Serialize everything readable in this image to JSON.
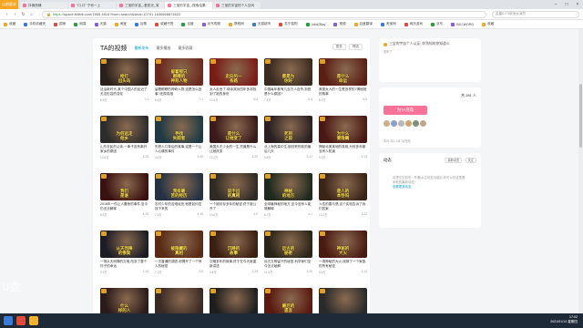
{
  "browser": {
    "badge": "以前版本",
    "tabs": [
      {
        "label": "拌佣侠辅",
        "active": false
      },
      {
        "label": "\"口,口\" 宁你一上",
        "active": false
      },
      {
        "label": "三宝的宇宙_-爱拔光_宵",
        "active": false
      },
      {
        "label": "三宝的宇宙_-搜索结果",
        "active": true
      },
      {
        "label": "三宝的宇宙的个人空间",
        "active": false
      }
    ],
    "url_scheme": "https://",
    "url": "space.bilibili.com/7855 4616?from=search&seid=10791 1636566874622",
    "search_placeholder": "金晨6173新旅女演员",
    "bookmarks": [
      "收藏",
      "手机收藏夹",
      "国家",
      "网易",
      "天猫",
      "淘宝",
      "谷歌",
      "收藏书签",
      "百度",
      "京东购物",
      "携程网",
      "天猫超市",
      "苏宁易购",
      "Jobs2Bay",
      "视频",
      "百度翻译",
      "淘宝网",
      "网页游戏",
      "京东",
      "BILI WORD",
      "收藏"
    ]
  },
  "main": {
    "title": "TA的视频",
    "tabs": [
      "最新发布",
      "最多播放",
      "最多收藏"
    ],
    "sort": [
      "更多",
      "筛选"
    ],
    "videos": [
      {
        "cap": "枪打\n出头鸟",
        "title": "法治新时代-某个中国人的走近了无法形容的变化",
        "views": "6.9万",
        "date": "7-1",
        "bg": "#2a1f1a"
      },
      {
        "cap": "留着那只\n眼睛的\n神奇人物",
        "title": "留着眼睛的神奇人物,这是怎么回事?还原真相",
        "views": "6.6万",
        "date": "7-1",
        "bg": "#6b2a1e"
      },
      {
        "cap": "走向另一\n条路",
        "title": "女人走丢了,母亲哭诉四年多却找到了她的身份",
        "views": "10.3万",
        "date": "6-3",
        "bg": "#7a1c16"
      },
      {
        "cap": "都是为\n你好",
        "title": "中国每年都有几百万人自杀,到底是什么原因?",
        "views": "7.4万",
        "date": "6-5",
        "bg": "#3a2a20"
      },
      {
        "cap": "是什么\n命运",
        "title": "美丽女人的一生是怎样的?揭秘她的故事",
        "views": "8.1万",
        "date": "6-5",
        "bg": "#5a1e14"
      },
      {
        "cap": "为何远走\n他乡",
        "title": "山东农民的父亲,一辈子没有离开家乡的原因",
        "views": "13.6万",
        "date": "5-25",
        "bg": "#2c2c2c"
      },
      {
        "cap": "寻找\n失踪者",
        "title": "失踪人口背后的故事,这是一个让人心痛的事件",
        "views": "4.6万",
        "date": "5-28",
        "bg": "#1f3a44"
      },
      {
        "cap": "是什么\n让她变了",
        "title": "美国天才少女的一生,究竟是什么让她改变",
        "views": "11.2万",
        "date": "5-30",
        "bg": "#3a1a1a"
      },
      {
        "cap": "死刑\n之前",
        "title": "北上海的高中生,被判死刑前的最后几天",
        "views": "5.8万",
        "date": "5-12",
        "bg": "#2a2022"
      },
      {
        "cap": "为什么\n要隐瞒",
        "title": "揭秘北美某地的真相,为何多年都没有人知道",
        "views": "9.3万",
        "date": "5-14",
        "bg": "#4a1814"
      },
      {
        "cap": "我们\n是谁",
        "title": "2018年一件让人震惊的事件,至今仍无法解释",
        "views": "8.8万",
        "date": "4-26",
        "bg": "#3a1010"
      },
      {
        "cap": "我有最\n苦的经历",
        "title": "农村少年的苦难经历,他是如何坚持下来的",
        "views": "7.6万",
        "date": "4-18",
        "bg": "#243244"
      },
      {
        "cap": "说不出\n的真相",
        "title": "一个被封存多年的秘密,终于被公开了",
        "views": "10.6万",
        "date": "4-9",
        "bg": "#2e2a24"
      },
      {
        "cap": "神秘\n的地方",
        "title": "全球最神秘的地方,至今没有人能够解释",
        "views": "6.2万",
        "date": "4-1",
        "bg": "#1e2a1e"
      },
      {
        "cap": "是人的\n本性吗",
        "title": "人性的善与恶,这个实验告诉了我们答案",
        "views": "12.4万",
        "date": "3-22",
        "bg": "#3a2418"
      },
      {
        "cap": "从天而降\n的惨案",
        "title": "一场从天而降的灾难,改变了整个村子的命运",
        "views": "9.9万",
        "date": "3-15",
        "bg": "#1c1c24"
      },
      {
        "cap": "被隐藏的\n真相",
        "title": "一次普通的调查,却揭开了一个惊人的秘密",
        "views": "7.2万",
        "date": "3-8",
        "bg": "#5a2a14"
      },
      {
        "cap": "沉睡的\n故事",
        "title": "沉睡多年的故事,终于在今天被重新讲述",
        "views": "5.4万",
        "date": "2-29",
        "bg": "#3a1e10"
      },
      {
        "cap": "远古的\n秘密",
        "title": "远古文明留下的秘密,科学家们至今无法破解",
        "views": "11.8万",
        "date": "2-20",
        "bg": "#2a2418"
      },
      {
        "cap": "神秘的\n大火",
        "title": "一场神秘的大火,烧掉了一个家族的所有秘密",
        "views": "8.5万",
        "date": "2-12",
        "bg": "#4a1a10"
      },
      {
        "cap": "什么\n样的人",
        "title": "他到底是什么样的人,为何让人如此难忘",
        "views": "6.7万",
        "date": "2-3",
        "bg": "#2a1a1a"
      },
      {
        "cap": "",
        "title": "",
        "views": "",
        "date": "",
        "bg": "#3a2a24"
      },
      {
        "cap": "",
        "title": "",
        "views": "",
        "date": "",
        "bg": "#1e1e1e"
      },
      {
        "cap": "最后的\n遗言",
        "title": "",
        "views": "",
        "date": "",
        "bg": "#5a1a10"
      },
      {
        "cap": "",
        "title": "",
        "views": "",
        "date": "",
        "bg": "#2a2a2a"
      }
    ]
  },
  "side": {
    "notice": "三宝的宇宙个人认证: 你熟知的你知道么",
    "notice_sub": "发布了",
    "fans_label": "关注数",
    "fans_count": "共 281 人",
    "charge_label": "为TA充电",
    "charge_foot": "本月 共1,136 TA充电",
    "dynamic_title": "动态",
    "dynamic_btns": [
      "最新动态",
      "关注"
    ],
    "empty_text": "这里空空如也~ 开通Up主动态功能后,你可以在这里看到他的最新动态~",
    "empty_link": "查看更多动态"
  },
  "taskbar": {
    "time": "17:02",
    "date": "2021/01/14 星期四"
  },
  "watermark": "U盘"
}
